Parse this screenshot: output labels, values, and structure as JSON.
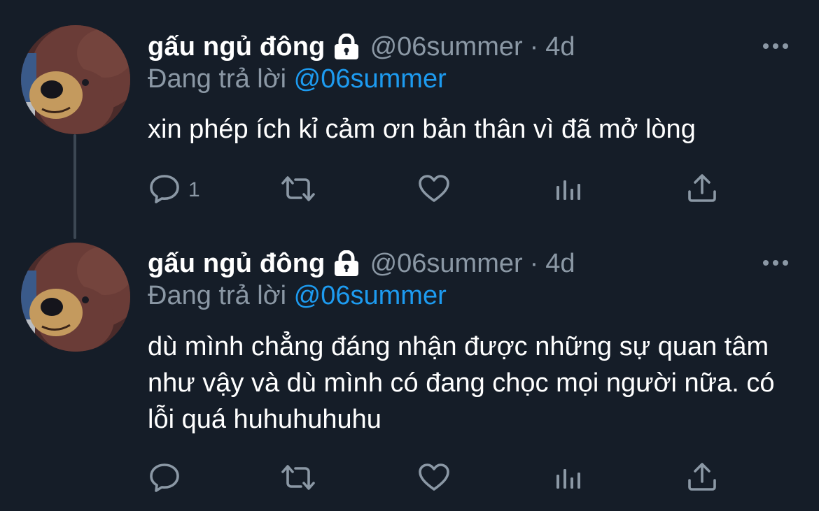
{
  "tweets": [
    {
      "display_name": "gấu ngủ đông",
      "handle": "@06summer",
      "separator": "·",
      "time": "4d",
      "reply_prefix": "Đang trả lời",
      "reply_to": "@06summer",
      "text": "xin phép ích kỉ cảm ơn bản thân vì đã mở lòng",
      "reply_count": "1"
    },
    {
      "display_name": "gấu ngủ đông",
      "handle": "@06summer",
      "separator": "·",
      "time": "4d",
      "reply_prefix": "Đang trả lời",
      "reply_to": "@06summer",
      "text": "dù mình chẳng đáng nhận được những sự quan tâm như vậy và dù mình có đang chọc mọi người nữa. có lỗi quá huhuhuhuhu",
      "reply_count": ""
    }
  ],
  "colors": {
    "background": "#151d28",
    "secondary_text": "#8b98a5",
    "accent": "#1d9bf0",
    "thread_line": "#3c4753"
  },
  "icons": [
    "lock-icon",
    "more-icon",
    "reply-icon",
    "retweet-icon",
    "like-icon",
    "views-icon",
    "share-icon"
  ]
}
